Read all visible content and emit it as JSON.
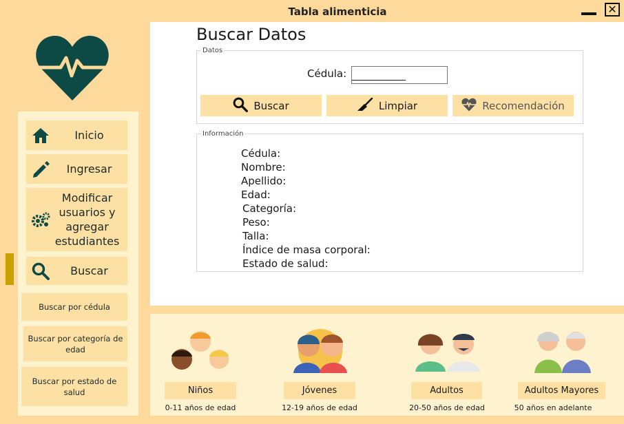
{
  "window": {
    "title": "Tabla alimenticia",
    "close_glyph": "✕"
  },
  "sidebar": {
    "items": [
      {
        "label": "Inicio",
        "icon": "home-icon"
      },
      {
        "label": "Ingresar",
        "icon": "pencil-icon"
      },
      {
        "label": "Modificar usuarios y agregar estudiantes",
        "icon": "gears-icon"
      },
      {
        "label": "Buscar",
        "icon": "search-icon"
      }
    ],
    "subitems": [
      {
        "label": "Buscar por cédula"
      },
      {
        "label": "Buscar por categoría de edad"
      },
      {
        "label": "Buscar por estado de salud"
      }
    ]
  },
  "main": {
    "heading": "Buscar Datos",
    "datos": {
      "legend": "Datos",
      "cedula_label": "Cédula:",
      "cedula_value": "__________"
    },
    "actions": {
      "buscar": "Buscar",
      "limpiar": "Limpiar",
      "recomendacion": "Recomendación"
    },
    "info": {
      "legend": "Información",
      "fields": [
        "Cédula:",
        "Nombre:",
        "Apellido:",
        "Edad:",
        "Categoría:",
        "Peso:",
        "Talla:",
        "Índice de masa corporal:",
        "Estado de salud:"
      ]
    }
  },
  "categories": [
    {
      "label": "Niños",
      "range": "0-11 años de edad",
      "icon": "children-icon"
    },
    {
      "label": "Jóvenes",
      "range": "12-19 años de edad",
      "icon": "youth-icon"
    },
    {
      "label": "Adultos",
      "range": "20-50 años de edad",
      "icon": "adults-icon"
    },
    {
      "label": "Adultos Mayores",
      "range": "50 años en adelante",
      "icon": "elderly-icon"
    }
  ],
  "colors": {
    "accent": "#c9a000",
    "brand": "#0d4a45",
    "panel": "#fde0a3",
    "background": "#fdd99b"
  }
}
